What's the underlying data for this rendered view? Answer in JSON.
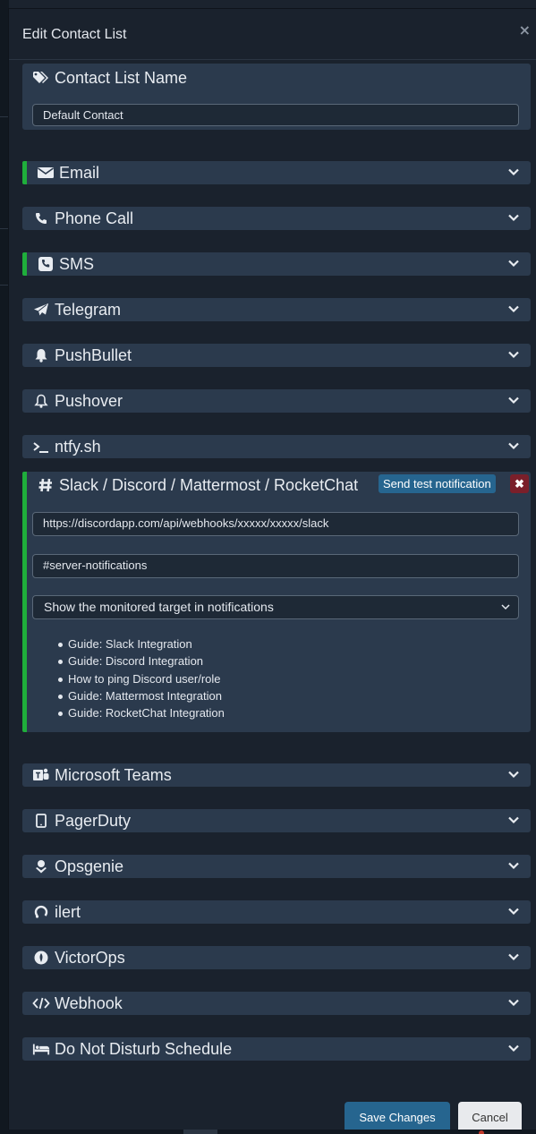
{
  "modal": {
    "title": "Edit Contact List",
    "close_glyph": "×"
  },
  "contact_list_name": {
    "label": "Contact List Name",
    "value": "Default Contact",
    "icon": "tags-icon"
  },
  "providers": [
    {
      "key": "email",
      "label": "Email",
      "icon": "envelope-icon",
      "enabled": true
    },
    {
      "key": "phone",
      "label": "Phone Call",
      "icon": "phone-icon",
      "enabled": false
    },
    {
      "key": "sms",
      "label": "SMS",
      "icon": "phone-square-icon",
      "enabled": true
    },
    {
      "key": "telegram",
      "label": "Telegram",
      "icon": "paper-plane-icon",
      "enabled": false
    },
    {
      "key": "pushbullet",
      "label": "PushBullet",
      "icon": "bell-icon",
      "enabled": false
    },
    {
      "key": "pushover",
      "label": "Pushover",
      "icon": "bell-outline-icon",
      "enabled": false
    },
    {
      "key": "ntfy",
      "label": "ntfy.sh",
      "icon": "terminal-icon",
      "enabled": false
    }
  ],
  "slack": {
    "label": "Slack / Discord / Mattermost / RocketChat",
    "icon": "hash-icon",
    "enabled": true,
    "test_button": "Send test notification",
    "remove_glyph": "✖",
    "webhook_url": "https://discordapp.com/api/webhooks/xxxxx/xxxxx/slack",
    "channel": "#server-notifications",
    "target_option": "Show the monitored target in notifications",
    "guides": [
      "Guide: Slack Integration",
      "Guide: Discord Integration",
      "How to ping Discord user/role",
      "Guide: Mattermost Integration",
      "Guide: RocketChat Integration"
    ]
  },
  "providers_after": [
    {
      "key": "teams",
      "label": "Microsoft Teams",
      "icon": "teams-icon"
    },
    {
      "key": "pagerduty",
      "label": "PagerDuty",
      "icon": "tablet-icon"
    },
    {
      "key": "opsgenie",
      "label": "Opsgenie",
      "icon": "opsgenie-icon"
    },
    {
      "key": "ilert",
      "label": "ilert",
      "icon": "ilert-icon"
    },
    {
      "key": "victorops",
      "label": "VictorOps",
      "icon": "victorops-icon"
    },
    {
      "key": "webhook",
      "label": "Webhook",
      "icon": "code-icon"
    },
    {
      "key": "dnd",
      "label": "Do Not Disturb Schedule",
      "icon": "bed-icon"
    }
  ],
  "footer": {
    "save_label": "Save Changes",
    "cancel_label": "Cancel"
  },
  "colors": {
    "accent_enabled": "#1fae3b",
    "panel": "#2b3a4d",
    "primary_button": "#26658f",
    "danger_button": "#7a1f2a"
  }
}
